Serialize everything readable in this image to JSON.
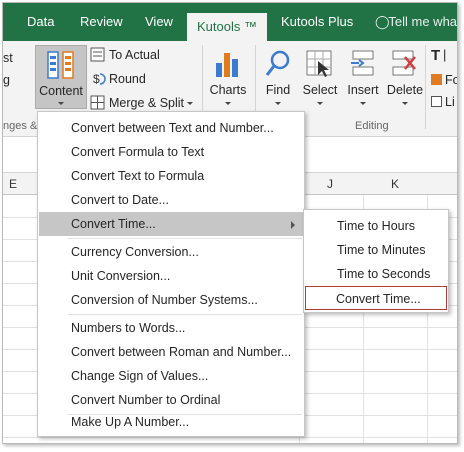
{
  "tabs": [
    {
      "label": "Data"
    },
    {
      "label": "Review"
    },
    {
      "label": "View"
    },
    {
      "label": "Kutools ™"
    },
    {
      "label": "Kutools Plus"
    }
  ],
  "tell_me": "Tell me wha",
  "ribbon": {
    "left_partial_1": "st",
    "left_partial_2": "g",
    "left_group_partial": "nges &",
    "content_label": "Content",
    "to_actual": "To Actual",
    "round": "Round",
    "merge_split": "Merge & Split",
    "charts": "Charts",
    "find": "Find",
    "select": "Select",
    "insert": "Insert",
    "delete": "Delete",
    "editing_group": "Editing",
    "t_partial": "T",
    "fo_partial": "Fo",
    "li_partial": "Li"
  },
  "columns": [
    "E",
    "J",
    "K"
  ],
  "content_menu": {
    "items": [
      {
        "label": "Convert between Text and Number..."
      },
      {
        "label": "Convert Formula to Text"
      },
      {
        "label": "Convert Text to Formula"
      },
      {
        "label": "Convert to Date..."
      },
      {
        "label": "Convert Time..."
      },
      {
        "label": "Currency Conversion..."
      },
      {
        "label": "Unit Conversion..."
      },
      {
        "label": "Conversion of Number Systems..."
      },
      {
        "label": "Numbers to Words..."
      },
      {
        "label": "Convert between Roman and Number..."
      },
      {
        "label": "Change Sign of Values..."
      },
      {
        "label": "Convert Number to Ordinal"
      },
      {
        "label": "Make Up A Number..."
      }
    ]
  },
  "time_submenu": {
    "items": [
      {
        "label": "Time to Hours"
      },
      {
        "label": "Time to Minutes"
      },
      {
        "label": "Time to Seconds"
      },
      {
        "label": "Convert Time..."
      }
    ]
  },
  "colors": {
    "accent": "#217346",
    "highlight": "#c6c6c6",
    "box_border": "#b33b3b"
  }
}
